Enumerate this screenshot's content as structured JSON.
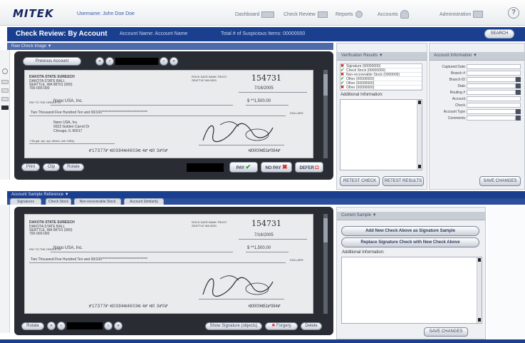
{
  "app": {
    "logo": "MITEK",
    "username": "Username: John Doe Doe"
  },
  "nav": [
    {
      "label": "Dashboard",
      "icon": "dashboard-icon"
    },
    {
      "label": "Check Review",
      "icon": "check-review-icon"
    },
    {
      "label": "Reports",
      "icon": "reports-icon"
    },
    {
      "label": "Accounts",
      "icon": "accounts-icon"
    },
    {
      "label": "Administration",
      "icon": "administration-icon"
    }
  ],
  "help": "?",
  "title": {
    "main": "Check Review: By Account",
    "account_name": "Account Name: Account Name",
    "total": "Total # of Suspicious Items: 00000000",
    "search": "SEARCH"
  },
  "top_panel": {
    "header": "Raw Check Image ▼",
    "prev_account": "Previous Account",
    "check": {
      "bank_name": "DAKOTA STATE SURESCH",
      "bank_lines": [
        "DAKOTA STATE BALL",
        "SEATTLE, WA 98701 (000)",
        "700-000-000"
      ],
      "number": "154731",
      "date": "7/16/2005",
      "fraction": "ROCK DATE BANK TRUST\nSEATTLE WA 0000",
      "amount_box": "$ **1,500.00",
      "pay_to_label": "PAY TO THE ORDER OF",
      "pay_to": "Nano USA, Inc.",
      "written": "Two Thousand Five Hundred Ten and 00/100*********************************",
      "dollars": "DOLLARS",
      "address": [
        "Nano USA, Inc.",
        "9322 Golden Carrot Dr",
        "Chicago, IL 60017"
      ],
      "memo": "7.56 gal. apr. apr. diesel; unb 1954y",
      "micr": "⑈17377⑈ ⑆0394⑆4603⑆ 4⑈ ⑆0 3⑈0⑈",
      "micr_right": "⑆0000⑆51⑈084⑈"
    },
    "tools": [
      "Print",
      "Clip",
      "Rotate"
    ],
    "actions": {
      "pay": "PAY",
      "no_pay": "NO PAY",
      "defer": "DEFER"
    }
  },
  "verification": {
    "header": "Verification Results ▼",
    "items": [
      {
        "status": "fail",
        "label": "Signature (00000000)"
      },
      {
        "status": "pass",
        "label": "Check Stock (00000000)"
      },
      {
        "status": "fail",
        "label": "Non-recoverable Stock (0000000)"
      },
      {
        "status": "pass",
        "label": "Other (00000000)"
      },
      {
        "status": "pass",
        "label": "Other (00000000)"
      },
      {
        "status": "fail",
        "label": "Other (00000000)"
      }
    ],
    "additional_label": "Additional Information:",
    "btn_reset_check": "RETEST CHECK",
    "btn_reset_results": "RETEST RESULTS"
  },
  "account_info": {
    "header": "Account Information ▼",
    "fields": [
      {
        "label": "Captured Date",
        "dropdown": false
      },
      {
        "label": "Branch #",
        "dropdown": false
      },
      {
        "label": "Branch ID",
        "dropdown": true
      },
      {
        "label": "Date",
        "dropdown": true
      },
      {
        "label": "Routing #",
        "dropdown": true
      },
      {
        "label": "Account",
        "dropdown": false
      },
      {
        "label": "Check",
        "dropdown": false
      },
      {
        "label": "Account Type",
        "dropdown": true
      },
      {
        "label": "Comments",
        "dropdown": true
      }
    ],
    "save": "SAVE CHANGES"
  },
  "bottom_panel": {
    "header": "Account Sample Reference ▼",
    "tabs": [
      "Signatures",
      "Check Stock",
      "Non-recoverable Stock",
      "Account Similarity"
    ],
    "tools_left": "Rotate",
    "btn_show_sig": "Show Signature (objects)",
    "btn_forgery": "Forgery",
    "btn_delete": "Delete"
  },
  "current_sample": {
    "header": "Current Sample ▼",
    "btn_add": "Add New Check Above as Signature Sample",
    "btn_replace": "Replace Signature Check with New Check Above",
    "additional_label": "Additional Information:",
    "save": "SAVE CHANGES"
  }
}
